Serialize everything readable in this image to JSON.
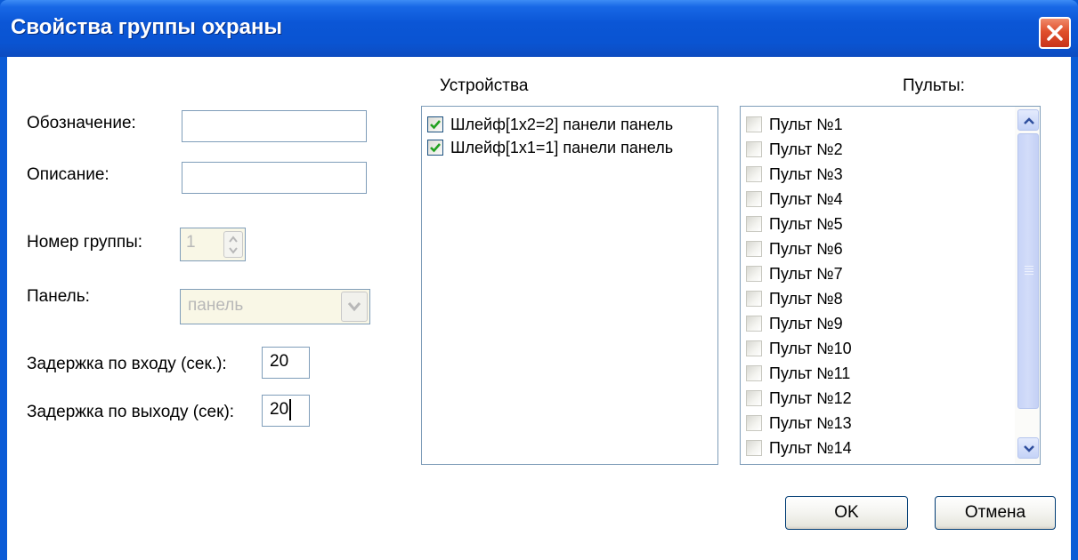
{
  "window": {
    "title": "Свойства группы охраны"
  },
  "form": {
    "designation_label": "Обозначение:",
    "designation_value": "",
    "description_label": "Описание:",
    "description_value": "",
    "group_number_label": "Номер группы:",
    "group_number_value": "1",
    "panel_label": "Панель:",
    "panel_value": "панель",
    "entry_delay_label": "Задержка по входу (сек.):",
    "entry_delay_value": "20",
    "exit_delay_label": "Задержка по выходу (сек):",
    "exit_delay_value": "20"
  },
  "devices": {
    "heading": "Устройства",
    "items": [
      {
        "label": "Шлейф[1x2=2] панели панель",
        "checked": true
      },
      {
        "label": "Шлейф[1x1=1] панели панель",
        "checked": true
      }
    ]
  },
  "consoles": {
    "heading": "Пульты:",
    "items": [
      {
        "label": "Пульт №1",
        "checked": false
      },
      {
        "label": "Пульт №2",
        "checked": false
      },
      {
        "label": "Пульт №3",
        "checked": false
      },
      {
        "label": "Пульт №4",
        "checked": false
      },
      {
        "label": "Пульт №5",
        "checked": false
      },
      {
        "label": "Пульт №6",
        "checked": false
      },
      {
        "label": "Пульт №7",
        "checked": false
      },
      {
        "label": "Пульт №8",
        "checked": false
      },
      {
        "label": "Пульт №9",
        "checked": false
      },
      {
        "label": "Пульт №10",
        "checked": false
      },
      {
        "label": "Пульт №11",
        "checked": false
      },
      {
        "label": "Пульт №12",
        "checked": false
      },
      {
        "label": "Пульт №13",
        "checked": false
      },
      {
        "label": "Пульт №14",
        "checked": false
      }
    ]
  },
  "buttons": {
    "ok": "OK",
    "cancel": "Отмена"
  },
  "colors": {
    "title_bar": "#0b56d6",
    "close_button": "#e0502c",
    "disabled_field": "#f9f7e6",
    "scrollbar_thumb": "#c8d4f7",
    "checkmark": "#21a121"
  },
  "icons": [
    "close-icon",
    "checkmark-icon",
    "spin-up-icon",
    "spin-down-icon",
    "dropdown-arrow-icon",
    "scroll-up-icon",
    "scroll-down-icon"
  ]
}
